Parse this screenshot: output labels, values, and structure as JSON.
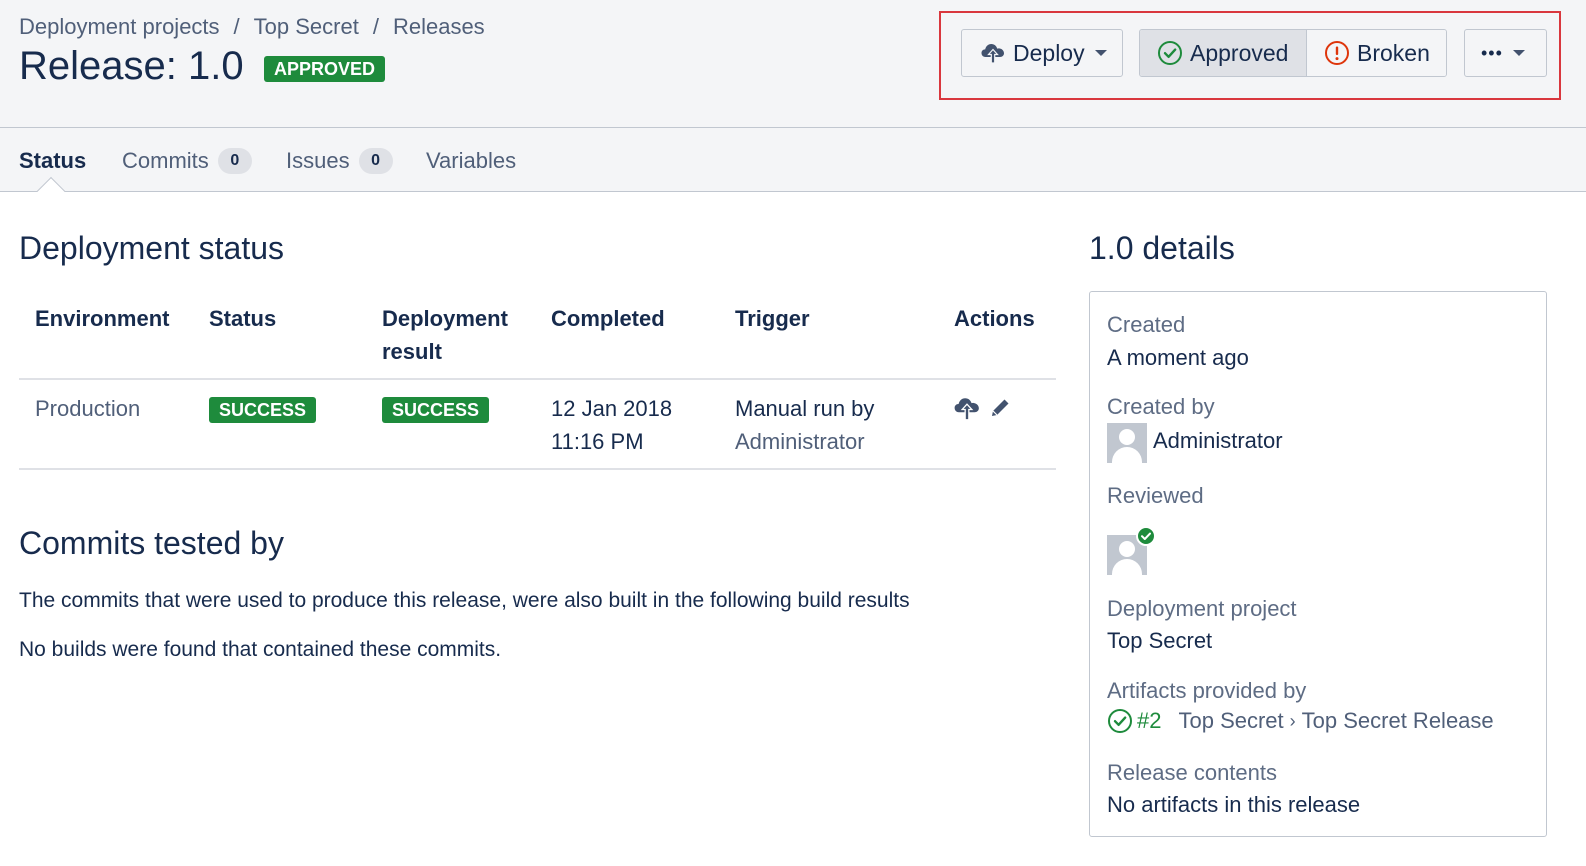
{
  "breadcrumb": [
    "Deployment projects",
    "Top Secret",
    "Releases"
  ],
  "breadcrumb_sep": "/",
  "title": "Release: 1.0",
  "title_status": "APPROVED",
  "toolbar": {
    "deploy_label": "Deploy",
    "approved_label": "Approved",
    "broken_label": "Broken",
    "more_label": "•••"
  },
  "tabs": [
    {
      "label": "Status",
      "active": true
    },
    {
      "label": "Commits",
      "badge": "0"
    },
    {
      "label": "Issues",
      "badge": "0"
    },
    {
      "label": "Variables"
    }
  ],
  "deployment_status": {
    "heading": "Deployment status",
    "columns": [
      "Environment",
      "Status",
      "Deployment result",
      "Completed",
      "Trigger",
      "Actions"
    ],
    "rows": [
      {
        "environment": "Production",
        "status": "SUCCESS",
        "result": "SUCCESS",
        "completed_date": "12 Jan 2018",
        "completed_time": "11:16 PM",
        "trigger_text": "Manual run by",
        "trigger_user": "Administrator",
        "actions": [
          "deploy-icon",
          "edit-icon"
        ]
      }
    ]
  },
  "commits_tested": {
    "heading": "Commits tested by",
    "description": "The commits that were used to produce this release, were also built in the following build results",
    "empty": "No builds were found that contained these commits."
  },
  "details": {
    "heading": "1.0 details",
    "created_label": "Created",
    "created_value": "A moment ago",
    "created_by_label": "Created by",
    "created_by_value": "Administrator",
    "reviewed_label": "Reviewed",
    "project_label": "Deployment project",
    "project_value": "Top Secret",
    "artifacts_label": "Artifacts provided by",
    "artifacts_build": "#2",
    "artifacts_project": "Top Secret",
    "artifacts_sep": "›",
    "artifacts_plan": "Top Secret Release",
    "contents_label": "Release contents",
    "contents_value": "No artifacts in this release"
  },
  "colors": {
    "success": "#1e8b3c",
    "broken": "#de350b",
    "highlight": "#d9373e"
  }
}
